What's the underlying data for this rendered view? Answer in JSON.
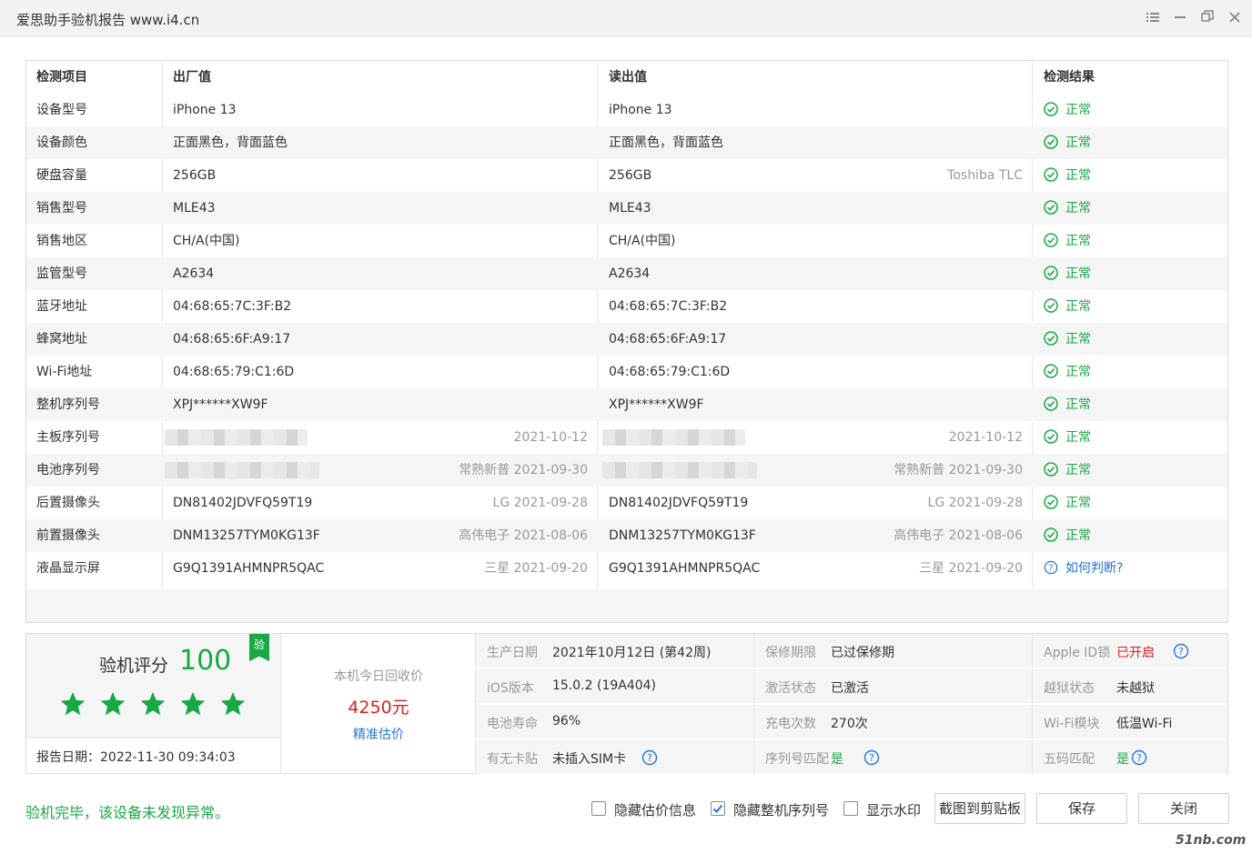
{
  "window": {
    "title": "爱思助手验机报告 www.i4.cn"
  },
  "table": {
    "headers": [
      "检测项目",
      "出厂值",
      "读出值",
      "检测结果"
    ],
    "rows": [
      {
        "item": "设备型号",
        "factory": "iPhone 13",
        "factory_note": "",
        "read": "iPhone 13",
        "read_note": "",
        "result": "正常",
        "status": "ok"
      },
      {
        "item": "设备颜色",
        "factory": "正面黑色，背面蓝色",
        "factory_note": "",
        "read": "正面黑色，背面蓝色",
        "read_note": "",
        "result": "正常",
        "status": "ok"
      },
      {
        "item": "硬盘容量",
        "factory": "256GB",
        "factory_note": "",
        "read": "256GB",
        "read_note": "Toshiba TLC",
        "result": "正常",
        "status": "ok"
      },
      {
        "item": "销售型号",
        "factory": "MLE43",
        "factory_note": "",
        "read": "MLE43",
        "read_note": "",
        "result": "正常",
        "status": "ok"
      },
      {
        "item": "销售地区",
        "factory": "CH/A(中国)",
        "factory_note": "",
        "read": "CH/A(中国)",
        "read_note": "",
        "result": "正常",
        "status": "ok"
      },
      {
        "item": "监管型号",
        "factory": "A2634",
        "factory_note": "",
        "read": "A2634",
        "read_note": "",
        "result": "正常",
        "status": "ok"
      },
      {
        "item": "蓝牙地址",
        "factory": "04:68:65:7C:3F:B2",
        "factory_note": "",
        "read": "04:68:65:7C:3F:B2",
        "read_note": "",
        "result": "正常",
        "status": "ok"
      },
      {
        "item": "蜂窝地址",
        "factory": "04:68:65:6F:A9:17",
        "factory_note": "",
        "read": "04:68:65:6F:A9:17",
        "read_note": "",
        "result": "正常",
        "status": "ok"
      },
      {
        "item": "Wi-Fi地址",
        "factory": "04:68:65:79:C1:6D",
        "factory_note": "",
        "read": "04:68:65:79:C1:6D",
        "read_note": "",
        "result": "正常",
        "status": "ok"
      },
      {
        "item": "整机序列号",
        "factory": "XPJ******XW9F",
        "factory_note": "",
        "read": "XPJ******XW9F",
        "read_note": "",
        "result": "正常",
        "status": "ok"
      },
      {
        "item": "主板序列号",
        "factory": "",
        "factory_note": "2021-10-12",
        "read": "",
        "read_note": "2021-10-12",
        "result": "正常",
        "status": "ok"
      },
      {
        "item": "电池序列号",
        "factory": "",
        "factory_note": "常熟新普 2021-09-30",
        "read": "",
        "read_note": "常熟新普 2021-09-30",
        "result": "正常",
        "status": "ok"
      },
      {
        "item": "后置摄像头",
        "factory": "DN81402JDVFQ59T19",
        "factory_note": "LG 2021-09-28",
        "read": "DN81402JDVFQ59T19",
        "read_note": "LG 2021-09-28",
        "result": "正常",
        "status": "ok"
      },
      {
        "item": "前置摄像头",
        "factory": "DNM13257TYM0KG13F",
        "factory_note": "高伟电子 2021-08-06",
        "read": "DNM13257TYM0KG13F",
        "read_note": "高伟电子 2021-08-06",
        "result": "正常",
        "status": "ok"
      },
      {
        "item": "液晶显示屏",
        "factory": "G9Q1391AHMNPR5QAC",
        "factory_note": "三星 2021-09-20",
        "read": "G9Q1391AHMNPR5QAC",
        "read_note": "三星 2021-09-20",
        "result": "如何判断?",
        "status": "help"
      }
    ]
  },
  "summary": {
    "score_label": "验机评分",
    "score": "100",
    "badge": "验",
    "rating": {
      "stars": 5,
      "max": 5
    },
    "report_date": "报告日期：2022-11-30 09:34:03",
    "price_label": "本机今日回收价",
    "price": "4250元",
    "price_link": "精准估价",
    "info": [
      {
        "key": "生产日期",
        "value": "2021年10月12日 (第42周)",
        "style": "normal",
        "help": false
      },
      {
        "key": "保修期限",
        "value": "已过保修期",
        "style": "normal",
        "help": false
      },
      {
        "key": "Apple ID锁",
        "value": "已开启",
        "style": "red",
        "help": true
      },
      {
        "key": "iOS版本",
        "value": "15.0.2 (19A404)",
        "style": "normal",
        "help": false
      },
      {
        "key": "激活状态",
        "value": "已激活",
        "style": "normal",
        "help": false
      },
      {
        "key": "越狱状态",
        "value": "未越狱",
        "style": "normal",
        "help": false
      },
      {
        "key": "电池寿命",
        "value": "96%",
        "style": "normal",
        "help": false
      },
      {
        "key": "充电次数",
        "value": "270次",
        "style": "normal",
        "help": false
      },
      {
        "key": "Wi-Fi模块",
        "value": "低温Wi-Fi",
        "style": "normal",
        "help": false
      },
      {
        "key": "有无卡贴",
        "value": "未插入SIM卡",
        "style": "normal",
        "help": true
      },
      {
        "key": "序列号匹配",
        "value": "是",
        "style": "green",
        "help": true
      },
      {
        "key": "五码匹配",
        "value": "是",
        "style": "green",
        "help": true
      }
    ]
  },
  "footer": {
    "message": "验机完毕，该设备未发现异常。",
    "checkboxes": [
      {
        "label": "隐藏估价信息",
        "checked": false
      },
      {
        "label": "隐藏整机序列号",
        "checked": true
      },
      {
        "label": "显示水印",
        "checked": false
      }
    ],
    "buttons": {
      "screenshot": "截图到剪贴板",
      "save": "保存",
      "close": "关闭"
    }
  },
  "watermark": "51nb.com",
  "colors": {
    "green": "#1aa845",
    "red": "#e02020",
    "blue": "#2673d9"
  }
}
